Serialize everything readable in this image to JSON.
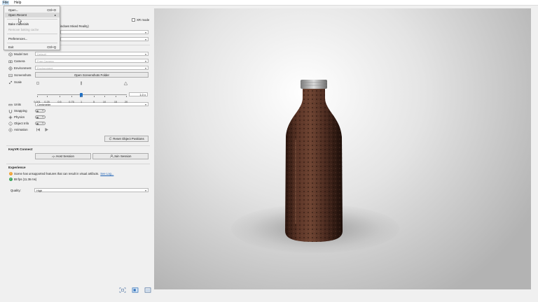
{
  "menubar": {
    "file": "File",
    "help": "Help"
  },
  "file_menu": {
    "open": "Open...",
    "open_shortcut": "Ctrl+O",
    "open_recent": "Open Recent",
    "bake_materials": "Bake materials",
    "remove_baking": "Remove baking cache",
    "preferences": "Preferences...",
    "exit": "Exit",
    "exit_shortcut": "Ctrl+Q"
  },
  "xr": {
    "label": "XR mode",
    "mixed_reality": "indows Mixed Reality)"
  },
  "settings": {
    "model_set": {
      "label": "Model Set",
      "value": "Default"
    },
    "camera": {
      "label": "Camera",
      "value": "Free Camera"
    },
    "environment": {
      "label": "Environment",
      "value": "Environment"
    },
    "screenshots": {
      "label": "Screenshots",
      "button": "Open Screenshots Folder"
    },
    "scale": {
      "label": "Scale",
      "value": "1.0 x",
      "ticks": [
        "0.001",
        "0.25",
        "0.5",
        "0.75",
        "1",
        "5",
        "10",
        "15",
        "20"
      ],
      "position": 0.49
    },
    "units": {
      "label": "Units",
      "value": "Centimeter"
    },
    "snapping": {
      "label": "Snapping"
    },
    "physics": {
      "label": "Physics"
    },
    "object_info": {
      "label": "Object Info"
    },
    "animation": {
      "label": "Animation"
    },
    "reset_button": "Reset Object Positions"
  },
  "keyvr": {
    "title": "KeyVR Connect",
    "host": "Host Session",
    "join": "Join Session"
  },
  "experience": {
    "title": "Experience",
    "warning": "Scene has unsupported features that can result in visual artifacts.",
    "warning_link": "See Log...",
    "fps": "88 fps (11.36 ms)",
    "quality_label": "Quality:",
    "quality_value": "High"
  },
  "colors": {
    "accent": "#1e6fc4",
    "bottle": "#4a2a1f",
    "warning": "#f0a030",
    "ok": "#3aa35a"
  }
}
